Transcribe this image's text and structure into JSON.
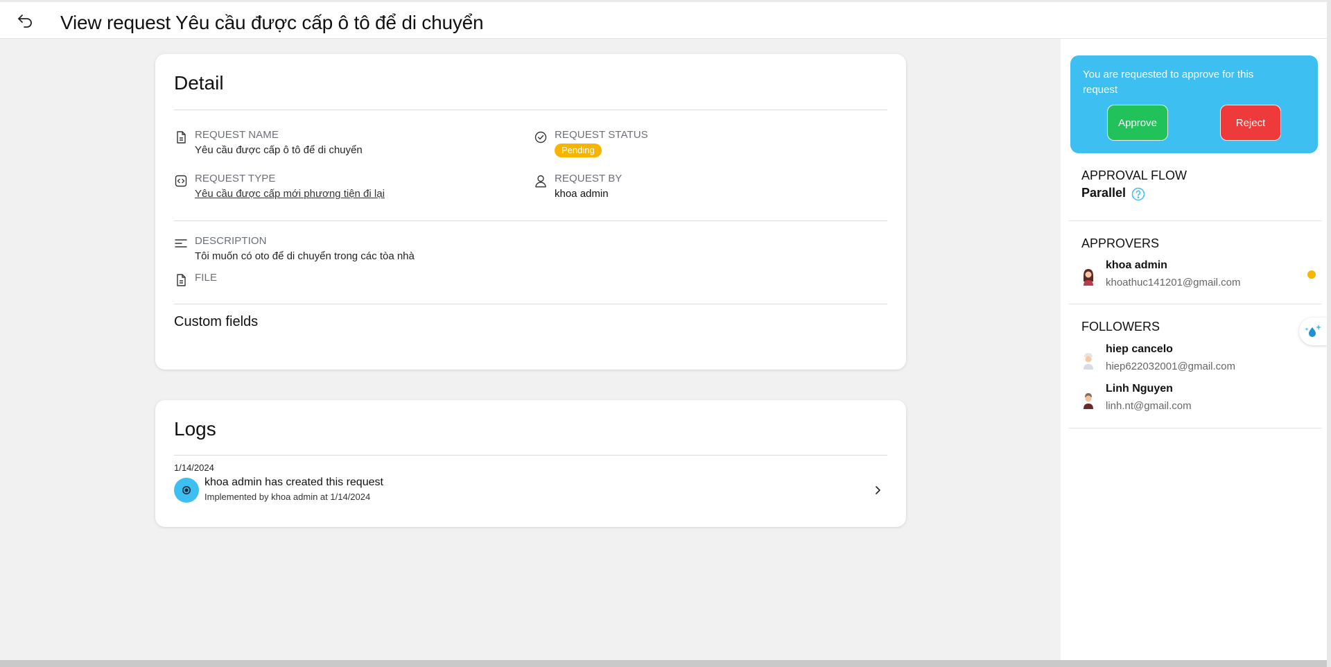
{
  "header": {
    "title": "View request Yêu cầu được cấp ô tô để di chuyển"
  },
  "detail": {
    "title": "Detail",
    "request_name": {
      "label": "REQUEST NAME",
      "value": "Yêu cầu được cấp ô tô để di chuyển"
    },
    "request_status": {
      "label": "REQUEST STATUS",
      "value": "Pending"
    },
    "request_type": {
      "label": "REQUEST TYPE",
      "value": "Yêu cầu được cấp mới phương tiện đi lại"
    },
    "request_by": {
      "label": "REQUEST BY",
      "value": "khoa admin"
    },
    "description": {
      "label": "DESCRIPTION",
      "value": "Tôi muốn có oto để di chuyển trong các tòa nhà"
    },
    "file": {
      "label": "FILE"
    },
    "custom_fields_title": "Custom fields"
  },
  "logs": {
    "title": "Logs",
    "items": [
      {
        "date": "1/14/2024",
        "title": "khoa admin has created this request",
        "subtitle": "Implemented by khoa admin at 1/14/2024"
      }
    ]
  },
  "panel": {
    "approval_prompt": "You are requested to approve for this request",
    "approve_label": "Approve",
    "reject_label": "Reject",
    "approval_flow_title": "APPROVAL FLOW",
    "approval_flow_value": "Parallel",
    "approvers_title": "APPROVERS",
    "approvers": [
      {
        "name": "khoa admin",
        "email": "khoathuc141201@gmail.com",
        "status_color": "#f8b500"
      }
    ],
    "followers_title": "FOLLOWERS",
    "followers": [
      {
        "name": "hiep cancelo",
        "email": "hiep622032001@gmail.com"
      },
      {
        "name": "Linh Nguyen",
        "email": "linh.nt@gmail.com"
      }
    ]
  },
  "colors": {
    "accent": "#3dbff2",
    "approve": "#22c25b",
    "reject": "#ee3a3a",
    "pending": "#f8b500"
  },
  "icons": [
    "back-arrow-icon",
    "document-icon",
    "check-circle-icon",
    "code-icon",
    "user-icon",
    "text-lines-icon",
    "file-icon",
    "gear-icon",
    "chevron-right-icon",
    "help-circle-icon",
    "avatar-icon",
    "sparkle-icon"
  ]
}
